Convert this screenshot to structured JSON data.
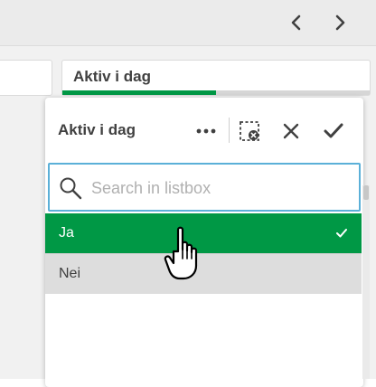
{
  "topbar": {
    "prev_icon": "chevron-left-icon",
    "next_icon": "chevron-right-icon"
  },
  "fieldbox": {
    "title": "Aktiv i dag",
    "selected_fraction": 0.5
  },
  "panel": {
    "title": "Aktiv i dag",
    "tools": [
      "more-options-icon",
      "clear-selection-icon",
      "cancel-icon",
      "confirm-icon"
    ],
    "search": {
      "placeholder": "Search in listbox",
      "value": ""
    },
    "items": [
      {
        "label": "Ja",
        "state": "selected"
      },
      {
        "label": "Nei",
        "state": "alternative"
      }
    ]
  },
  "colors": {
    "selected": "#009845",
    "alternative": "#dddddd",
    "search_border": "#5bb0d8"
  }
}
